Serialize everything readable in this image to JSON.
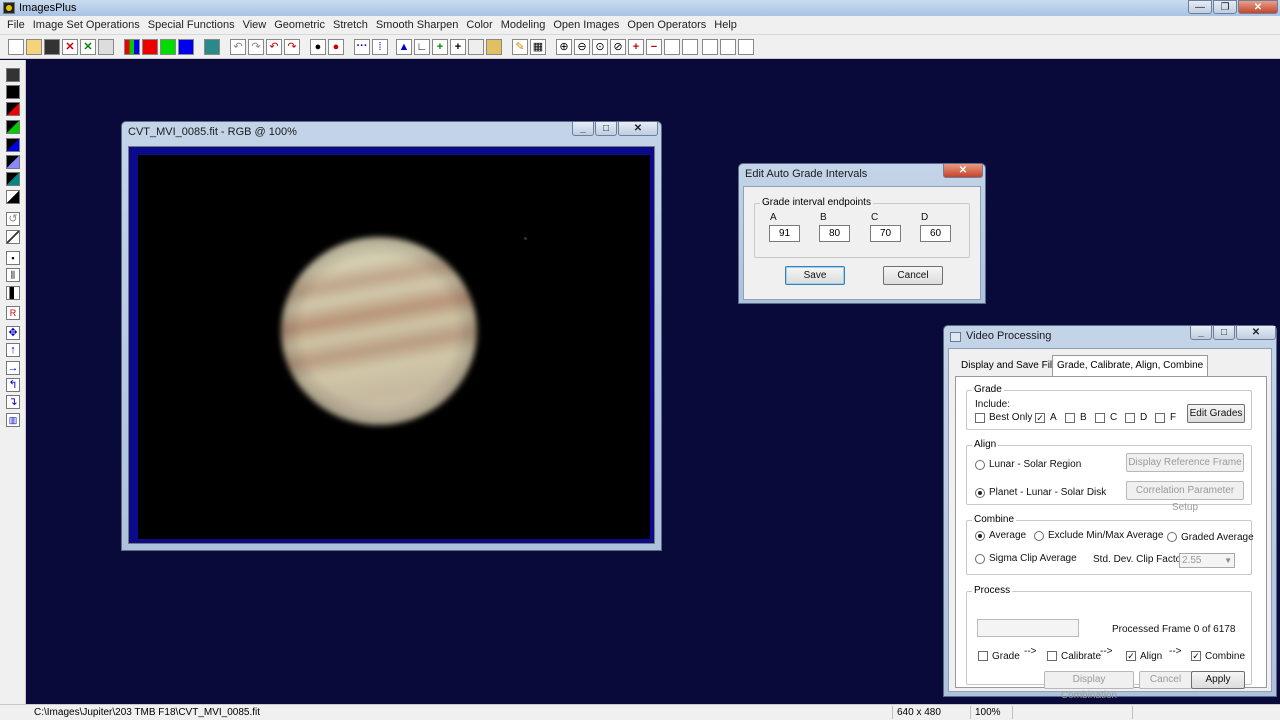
{
  "app": {
    "title": "ImagesPlus"
  },
  "menu": [
    "File",
    "Image Set Operations",
    "Special Functions",
    "View",
    "Geometric",
    "Stretch",
    "Smooth Sharpen",
    "Color",
    "Modeling",
    "Open Images",
    "Open Operators",
    "Help"
  ],
  "image_window": {
    "title": "CVT_MVI_0085.fit - RGB @ 100%"
  },
  "grade_dialog": {
    "title": "Edit Auto Grade Intervals",
    "group_label": "Grade interval endpoints",
    "columns": [
      {
        "label": "A",
        "value": "91"
      },
      {
        "label": "B",
        "value": "80"
      },
      {
        "label": "C",
        "value": "70"
      },
      {
        "label": "D",
        "value": "60"
      }
    ],
    "save_label": "Save",
    "cancel_label": "Cancel"
  },
  "video": {
    "title": "Video Processing",
    "tabs": [
      "Display and Save Files",
      "Grade, Calibrate, Align,  Combine"
    ],
    "grade": {
      "label": "Grade",
      "include_label": "Include:",
      "options": [
        {
          "label": "Best Only",
          "checked": false
        },
        {
          "label": "A",
          "checked": true
        },
        {
          "label": "B",
          "checked": false
        },
        {
          "label": "C",
          "checked": false
        },
        {
          "label": "D",
          "checked": false
        },
        {
          "label": "F",
          "checked": false
        }
      ],
      "edit_button": "Edit Grades"
    },
    "align": {
      "label": "Align",
      "option1": "Lunar - Solar Region",
      "option2": "Planet - Lunar - Solar Disk",
      "button1": "Display Reference Frame",
      "button2": "Correlation Parameter Setup"
    },
    "combine": {
      "label": "Combine",
      "average": "Average",
      "exclude": "Exclude Min/Max Average",
      "graded": "Graded Average",
      "sigma": "Sigma Clip Average",
      "std_label": "Std. Dev. Clip Factor:",
      "std_value": "2.55"
    },
    "process": {
      "label": "Process",
      "progress": 0,
      "status": "Processed Frame 0 of 6178",
      "steps": [
        {
          "label": "Grade",
          "checked": false
        },
        {
          "label": "Calibrate",
          "checked": false
        },
        {
          "label": "Align",
          "checked": true
        },
        {
          "label": "Combine",
          "checked": true
        }
      ],
      "arrow": "-->",
      "display_button": "Display Combination",
      "cancel_button": "Cancel",
      "apply_button": "Apply"
    }
  },
  "status": {
    "path": "C:\\Images\\Jupiter\\203 TMB F18\\CVT_MVI_0085.fit",
    "size": "640 x 480",
    "zoom": "100%"
  },
  "colors": {
    "desktop": "#0a0a3a",
    "image_frame": "#0a0a8a"
  }
}
